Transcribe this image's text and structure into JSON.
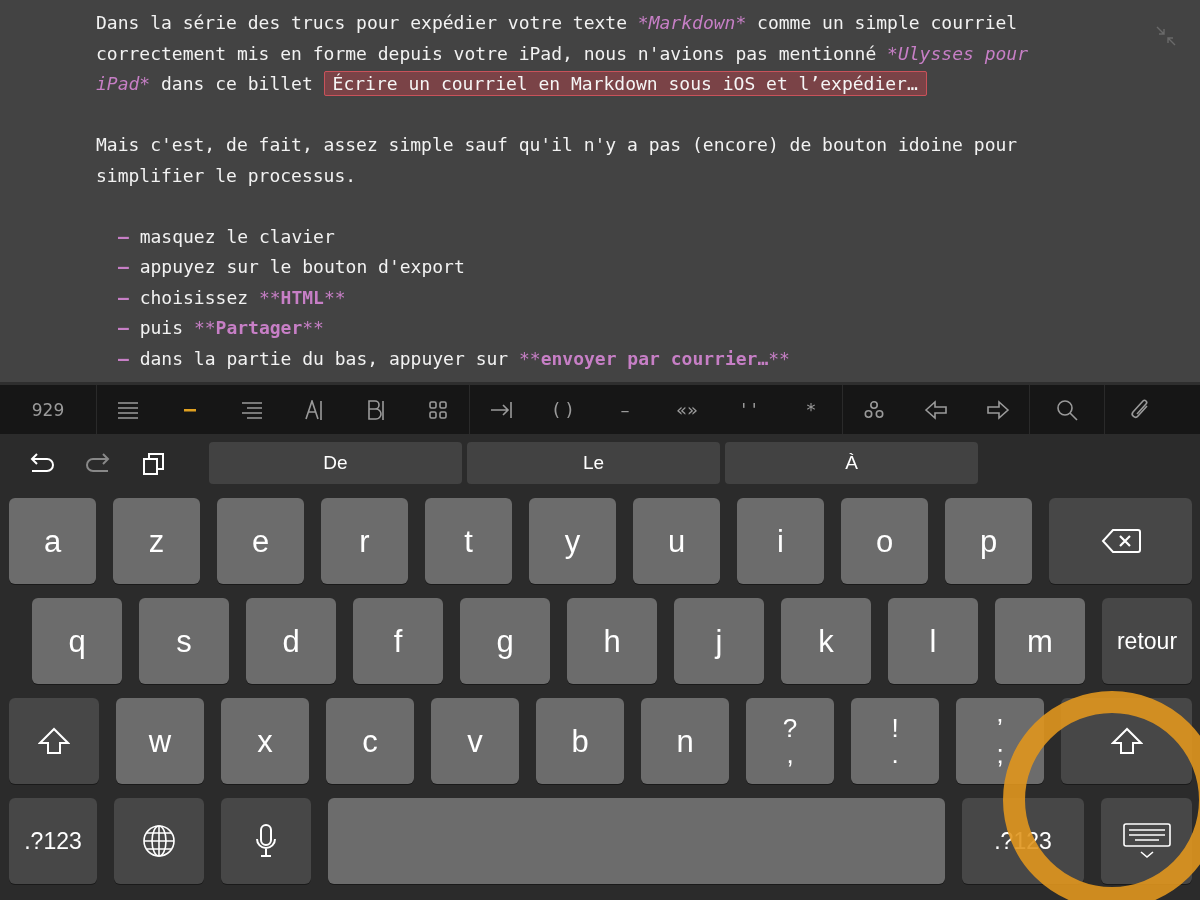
{
  "editor": {
    "paragraphs": [
      {
        "segments": [
          {
            "kind": "plain",
            "text": "Dans la série des trucs pour expédier votre texte "
          },
          {
            "kind": "italic",
            "text": "*Markdown*"
          },
          {
            "kind": "plain",
            "text": " comme un simple courriel correctement mis en forme depuis votre iPad, nous n'avions pas mentionné "
          },
          {
            "kind": "italic",
            "text": "*Ulysses pour iPad*"
          },
          {
            "kind": "plain",
            "text": " dans ce billet "
          },
          {
            "kind": "link",
            "text": "Écrire un courriel en Markdown sous iOS et l’expédier…"
          }
        ]
      },
      {
        "segments": [
          {
            "kind": "plain",
            "text": "Mais c'est, de fait, assez simple sauf qu'il n'y a pas (encore) de bouton idoine pour simplifier le processus."
          }
        ]
      }
    ],
    "list": [
      {
        "bullet": "–",
        "segments": [
          {
            "kind": "plain",
            "text": "masquez le clavier"
          }
        ]
      },
      {
        "bullet": "–",
        "segments": [
          {
            "kind": "plain",
            "text": "appuyez sur le bouton d'export"
          }
        ]
      },
      {
        "bullet": "–",
        "segments": [
          {
            "kind": "plain",
            "text": "choisissez "
          },
          {
            "kind": "marker",
            "text": "**"
          },
          {
            "kind": "bold",
            "text": "HTML"
          },
          {
            "kind": "marker",
            "text": "**"
          }
        ]
      },
      {
        "bullet": "–",
        "segments": [
          {
            "kind": "plain",
            "text": "puis "
          },
          {
            "kind": "marker",
            "text": "**"
          },
          {
            "kind": "bold",
            "text": "Partager"
          },
          {
            "kind": "marker",
            "text": "**"
          }
        ]
      },
      {
        "bullet": "–",
        "segments": [
          {
            "kind": "plain",
            "text": "dans la partie du bas, appuyer sur "
          },
          {
            "kind": "marker",
            "text": "**"
          },
          {
            "kind": "bold",
            "text": "envoyer par courrier…"
          },
          {
            "kind": "marker",
            "text": "**"
          }
        ]
      }
    ]
  },
  "toolbar": {
    "counter": "929",
    "symbols": [
      "( )",
      "–",
      "«»",
      "' '",
      "*"
    ]
  },
  "suggestions": [
    "De",
    "Le",
    "À"
  ],
  "keyboard": {
    "rows": [
      {
        "keys": [
          {
            "kind": "letter",
            "label": "a"
          },
          {
            "kind": "letter",
            "label": "z"
          },
          {
            "kind": "letter",
            "label": "e"
          },
          {
            "kind": "letter",
            "label": "r"
          },
          {
            "kind": "letter",
            "label": "t"
          },
          {
            "kind": "letter",
            "label": "y"
          },
          {
            "kind": "letter",
            "label": "u"
          },
          {
            "kind": "letter",
            "label": "i"
          },
          {
            "kind": "letter",
            "label": "o"
          },
          {
            "kind": "letter",
            "label": "p"
          },
          {
            "kind": "backspace"
          }
        ]
      },
      {
        "keys": [
          {
            "kind": "letter",
            "label": "q"
          },
          {
            "kind": "letter",
            "label": "s"
          },
          {
            "kind": "letter",
            "label": "d"
          },
          {
            "kind": "letter",
            "label": "f"
          },
          {
            "kind": "letter",
            "label": "g"
          },
          {
            "kind": "letter",
            "label": "h"
          },
          {
            "kind": "letter",
            "label": "j"
          },
          {
            "kind": "letter",
            "label": "k"
          },
          {
            "kind": "letter",
            "label": "l"
          },
          {
            "kind": "letter",
            "label": "m"
          },
          {
            "kind": "return",
            "label": "retour"
          }
        ]
      },
      {
        "keys": [
          {
            "kind": "shift"
          },
          {
            "kind": "letter",
            "label": "w"
          },
          {
            "kind": "letter",
            "label": "x"
          },
          {
            "kind": "letter",
            "label": "c"
          },
          {
            "kind": "letter",
            "label": "v"
          },
          {
            "kind": "letter",
            "label": "b"
          },
          {
            "kind": "letter",
            "label": "n"
          },
          {
            "kind": "dual",
            "top": "?",
            "bottom": ","
          },
          {
            "kind": "dual",
            "top": "!",
            "bottom": "."
          },
          {
            "kind": "dual",
            "top": "’",
            "bottom": ";"
          },
          {
            "kind": "shift"
          }
        ]
      },
      {
        "keys": [
          {
            "kind": "mode",
            "label": ".?123"
          },
          {
            "kind": "globe"
          },
          {
            "kind": "mic"
          },
          {
            "kind": "space"
          },
          {
            "kind": "mode",
            "label": ".?123"
          },
          {
            "kind": "hide"
          }
        ]
      }
    ]
  }
}
